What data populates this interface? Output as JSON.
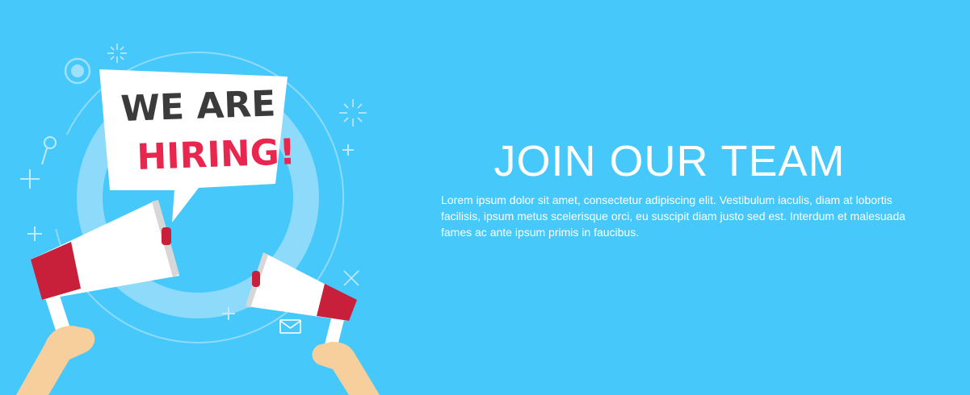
{
  "banner": {
    "headline": "JOIN OUR TEAM",
    "body": "Lorem ipsum dolor sit amet, consectetur adipiscing elit. Vestibulum iaculis, diam at lobortis facilisis, ipsum metus scelerisque orci, eu suscipit diam justo sed est. Interdum et malesuada fames ac ante ipsum primis in faucibus."
  },
  "bubble": {
    "line1": "WE ARE",
    "line2": "HIRING!"
  },
  "colors": {
    "background": "#46c8fb",
    "circle": "#96dcfb",
    "bubble_text_dark": "#3b3b3b",
    "bubble_text_accent": "#e8264e",
    "megaphone_red": "#c8203b",
    "skin": "#f7cf9c"
  },
  "icons": [
    "megaphone-icon",
    "hand-icon",
    "mail-icon",
    "sparkle-icon",
    "plus-icon",
    "pin-icon",
    "target-icon"
  ]
}
